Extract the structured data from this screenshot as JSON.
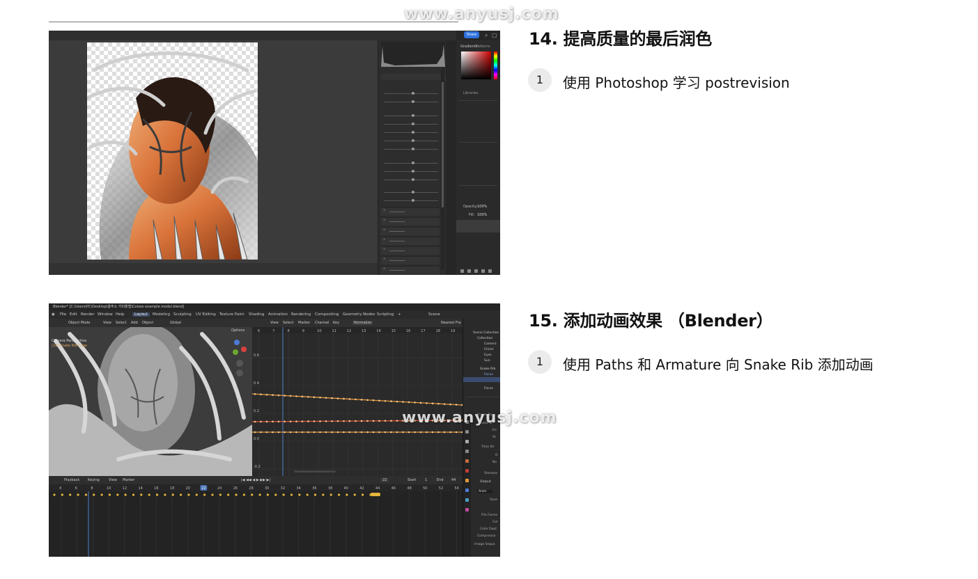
{
  "sections": [
    {
      "heading": "14. 提高质量的最后润色",
      "items": [
        {
          "number": "1",
          "text": "使用 Photoshop 学习 postrevision"
        }
      ]
    },
    {
      "heading": "15. 添加动画效果 （Blender）",
      "items": [
        {
          "number": "1",
          "text": "使用 Paths 和 Armature 向 Snake Rib 添加动画"
        }
      ]
    }
  ],
  "watermark": "www.anyusj.com",
  "photoshop": {
    "share_label": "Share",
    "tab_gradients": "Gradients",
    "tab_patterns": "Patterns",
    "tab_libraries": "Libraries",
    "opacity_label": "Opacity:",
    "opacity_value": "100%",
    "fill_label": "Fill:",
    "fill_value": "100%",
    "panel_sections": [
      "Curves",
      "Detail",
      "Color Mixer",
      "Color Grading",
      "Optics",
      "Geometry",
      "Effects"
    ]
  },
  "blender": {
    "title": "Blender* [C:\\Users\\PC\\Desktop\\홍주소 카피플랩\\Coloso example model.blend]",
    "menu": [
      "File",
      "Edit",
      "Render",
      "Window",
      "Help"
    ],
    "workspace_tabs": [
      "Layout",
      "Modeling",
      "Sculpting",
      "UV Editing",
      "Texture Paint",
      "Shading",
      "Animation",
      "Rendering",
      "Compositing",
      "Geometry Nodes",
      "Scripting"
    ],
    "active_tab": "Layout",
    "scene_label": "Scene",
    "viewport_header": [
      "Object Mode",
      "View",
      "Select",
      "Add",
      "Object"
    ],
    "transform_label": "Global",
    "options_label": "Options",
    "viewport_label": "Camera Perspective",
    "viewport_sublabel": "(22) Snake Rib Cage",
    "graph_header": [
      "View",
      "Select",
      "Marker",
      "Channel",
      "Key"
    ],
    "normalize_label": "Normalize",
    "nearest_label": "Nearest Fra",
    "graph_frames": [
      "6",
      "7",
      "8",
      "9",
      "10",
      "11",
      "12",
      "13",
      "14",
      "15",
      "16",
      "17",
      "18",
      "19"
    ],
    "graph_values": [
      "0.6",
      "0.4",
      "0.2",
      "0.0",
      "-0.2"
    ],
    "timeline_header": [
      "Playback",
      "Keying",
      "View",
      "Marker"
    ],
    "current_frame": "22",
    "start_label": "Start",
    "start_value": "1",
    "end_label": "End",
    "end_value": "44",
    "timeline_frames": [
      "4",
      "6",
      "8",
      "10",
      "12",
      "14",
      "16",
      "18",
      "20",
      "22",
      "24",
      "26",
      "28",
      "30",
      "32",
      "34",
      "36",
      "38",
      "40",
      "42",
      "44",
      "46",
      "48",
      "50",
      "52",
      "54"
    ],
    "outliner_items": [
      "Scene Collection",
      "Collection",
      "Camera",
      "Christ",
      "Eyes",
      "Sun",
      "Snake Rib",
      "Focus",
      "Focus"
    ],
    "properties_labels": [
      "Frame Ra",
      "Frame St",
      "En",
      "St",
      "Time Str",
      "O",
      "Ne",
      "Stereosc",
      "Output",
      "Anim",
      "Save",
      "File Forma",
      "Col",
      "Color Dept",
      "Compressio",
      "Image Seque"
    ]
  },
  "colors": {
    "heading": "#111111",
    "badge_bg": "#ebebeb",
    "curve_orange": "#e8973a",
    "curve_red": "#e0533c",
    "playhead": "#4772b3",
    "keyframe": "#e5b53a"
  }
}
